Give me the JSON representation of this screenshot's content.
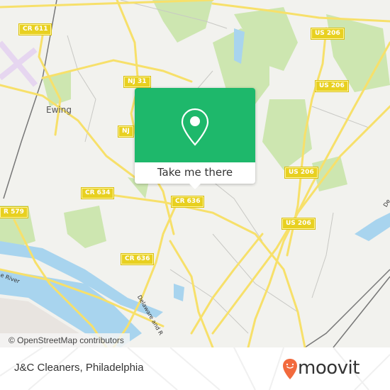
{
  "map": {
    "place_labels": [
      {
        "id": "ewing",
        "text": "Ewing"
      }
    ],
    "river_labels": [
      {
        "id": "delaware-river",
        "text": "e River"
      },
      {
        "id": "delaware-raritan",
        "text": "Delaware and R"
      },
      {
        "id": "delaware-east",
        "text": "De"
      }
    ],
    "road_shields": [
      {
        "id": "cr611",
        "text": "CR 611"
      },
      {
        "id": "nj31-a",
        "text": "NJ 31"
      },
      {
        "id": "nj31-b",
        "text": "NJ"
      },
      {
        "id": "us206-a",
        "text": "US 206"
      },
      {
        "id": "us206-b",
        "text": "US 206"
      },
      {
        "id": "us206-c",
        "text": "US 206"
      },
      {
        "id": "us206-d",
        "text": "US 206"
      },
      {
        "id": "cr634",
        "text": "CR 634"
      },
      {
        "id": "cr636-a",
        "text": "CR 636"
      },
      {
        "id": "cr636-b",
        "text": "CR 636"
      },
      {
        "id": "cr579",
        "text": "R 579"
      }
    ],
    "attribution": "© OpenStreetMap contributors",
    "colors": {
      "land": "#f2f2ee",
      "park": "#cde6b0",
      "water": "#a8d4ee",
      "road": "#f7e06a",
      "shield": "#e8d020"
    }
  },
  "popup": {
    "icon": "location-pin-icon",
    "button_label": "Take me there",
    "accent_color": "#1eb86b"
  },
  "footer": {
    "place_name": "J&C Cleaners, Philadelphia",
    "brand": "moovit",
    "brand_color": "#f26a3d"
  }
}
